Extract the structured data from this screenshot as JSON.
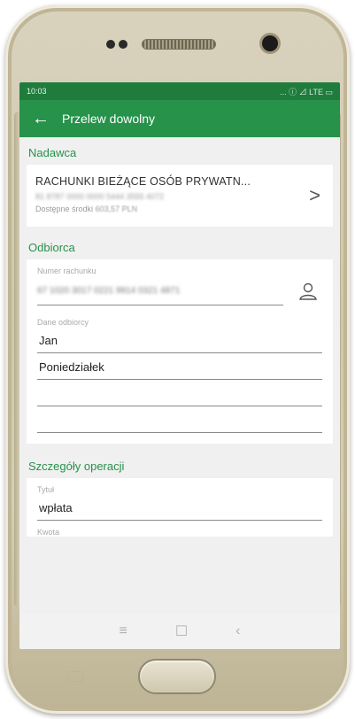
{
  "status_bar": {
    "time": "10:03",
    "indicators": "... ⓘ ⊿ LTE ▭"
  },
  "app_bar": {
    "back_icon": "←",
    "title": "Przelew dowolny"
  },
  "sender": {
    "section_title": "Nadawca",
    "account_name": "RACHUNKI BIEŻĄCE OSÓB PRYWATN...",
    "account_number": "81 8787 0000 0000 5444 3555 4072",
    "funds_label": "Dostępne środki",
    "funds_value": "603,57 PLN",
    "chevron": ">"
  },
  "recipient": {
    "section_title": "Odbiorca",
    "account_label": "Numer rachunku",
    "account_value": "67 1020 3017 0221 9914 0321 4871",
    "name_label": "Dane odbiorcy",
    "name_lines": [
      "Jan",
      "Poniedziałek",
      "",
      ""
    ]
  },
  "details": {
    "section_title": "Szczegóły operacji",
    "title_label": "Tytuł",
    "title_value": "wpłata",
    "amount_label": "Kwota"
  },
  "nav_bar": {
    "recent": "≡",
    "home": "☐",
    "back": "‹"
  }
}
